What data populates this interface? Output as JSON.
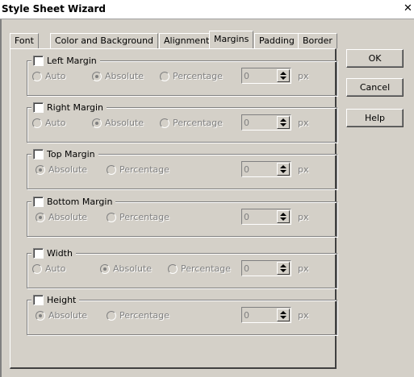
{
  "window": {
    "title": "Style Sheet Wizard",
    "close_glyph": "✕"
  },
  "tabs": [
    {
      "label": "Font"
    },
    {
      "label": "Color and Background"
    },
    {
      "label": "Alignment"
    },
    {
      "label": "Margins"
    },
    {
      "label": "Padding"
    },
    {
      "label": "Border"
    }
  ],
  "active_tab": "Margins",
  "groups": [
    {
      "label": "Left Margin",
      "checked": false,
      "options": [
        "Auto",
        "Absolute",
        "Percentage"
      ],
      "selected": "Absolute",
      "value": "0",
      "unit": "px"
    },
    {
      "label": "Right Margin",
      "checked": false,
      "options": [
        "Auto",
        "Absolute",
        "Percentage"
      ],
      "selected": "Absolute",
      "value": "0",
      "unit": "px"
    },
    {
      "label": "Top Margin",
      "checked": false,
      "options": [
        "Absolute",
        "Percentage"
      ],
      "selected": "Absolute",
      "value": "0",
      "unit": "px"
    },
    {
      "label": "Bottom Margin",
      "checked": false,
      "options": [
        "Absolute",
        "Percentage"
      ],
      "selected": "Absolute",
      "value": "0",
      "unit": "px"
    },
    {
      "label": "Width",
      "checked": false,
      "options": [
        "Auto",
        "Absolute",
        "Percentage"
      ],
      "selected": "Absolute",
      "value": "0",
      "unit": "px"
    },
    {
      "label": "Height",
      "checked": false,
      "options": [
        "Absolute",
        "Percentage"
      ],
      "selected": "Absolute",
      "value": "0",
      "unit": "px"
    }
  ],
  "buttons": {
    "ok": "OK",
    "cancel": "Cancel",
    "help": "Help"
  }
}
